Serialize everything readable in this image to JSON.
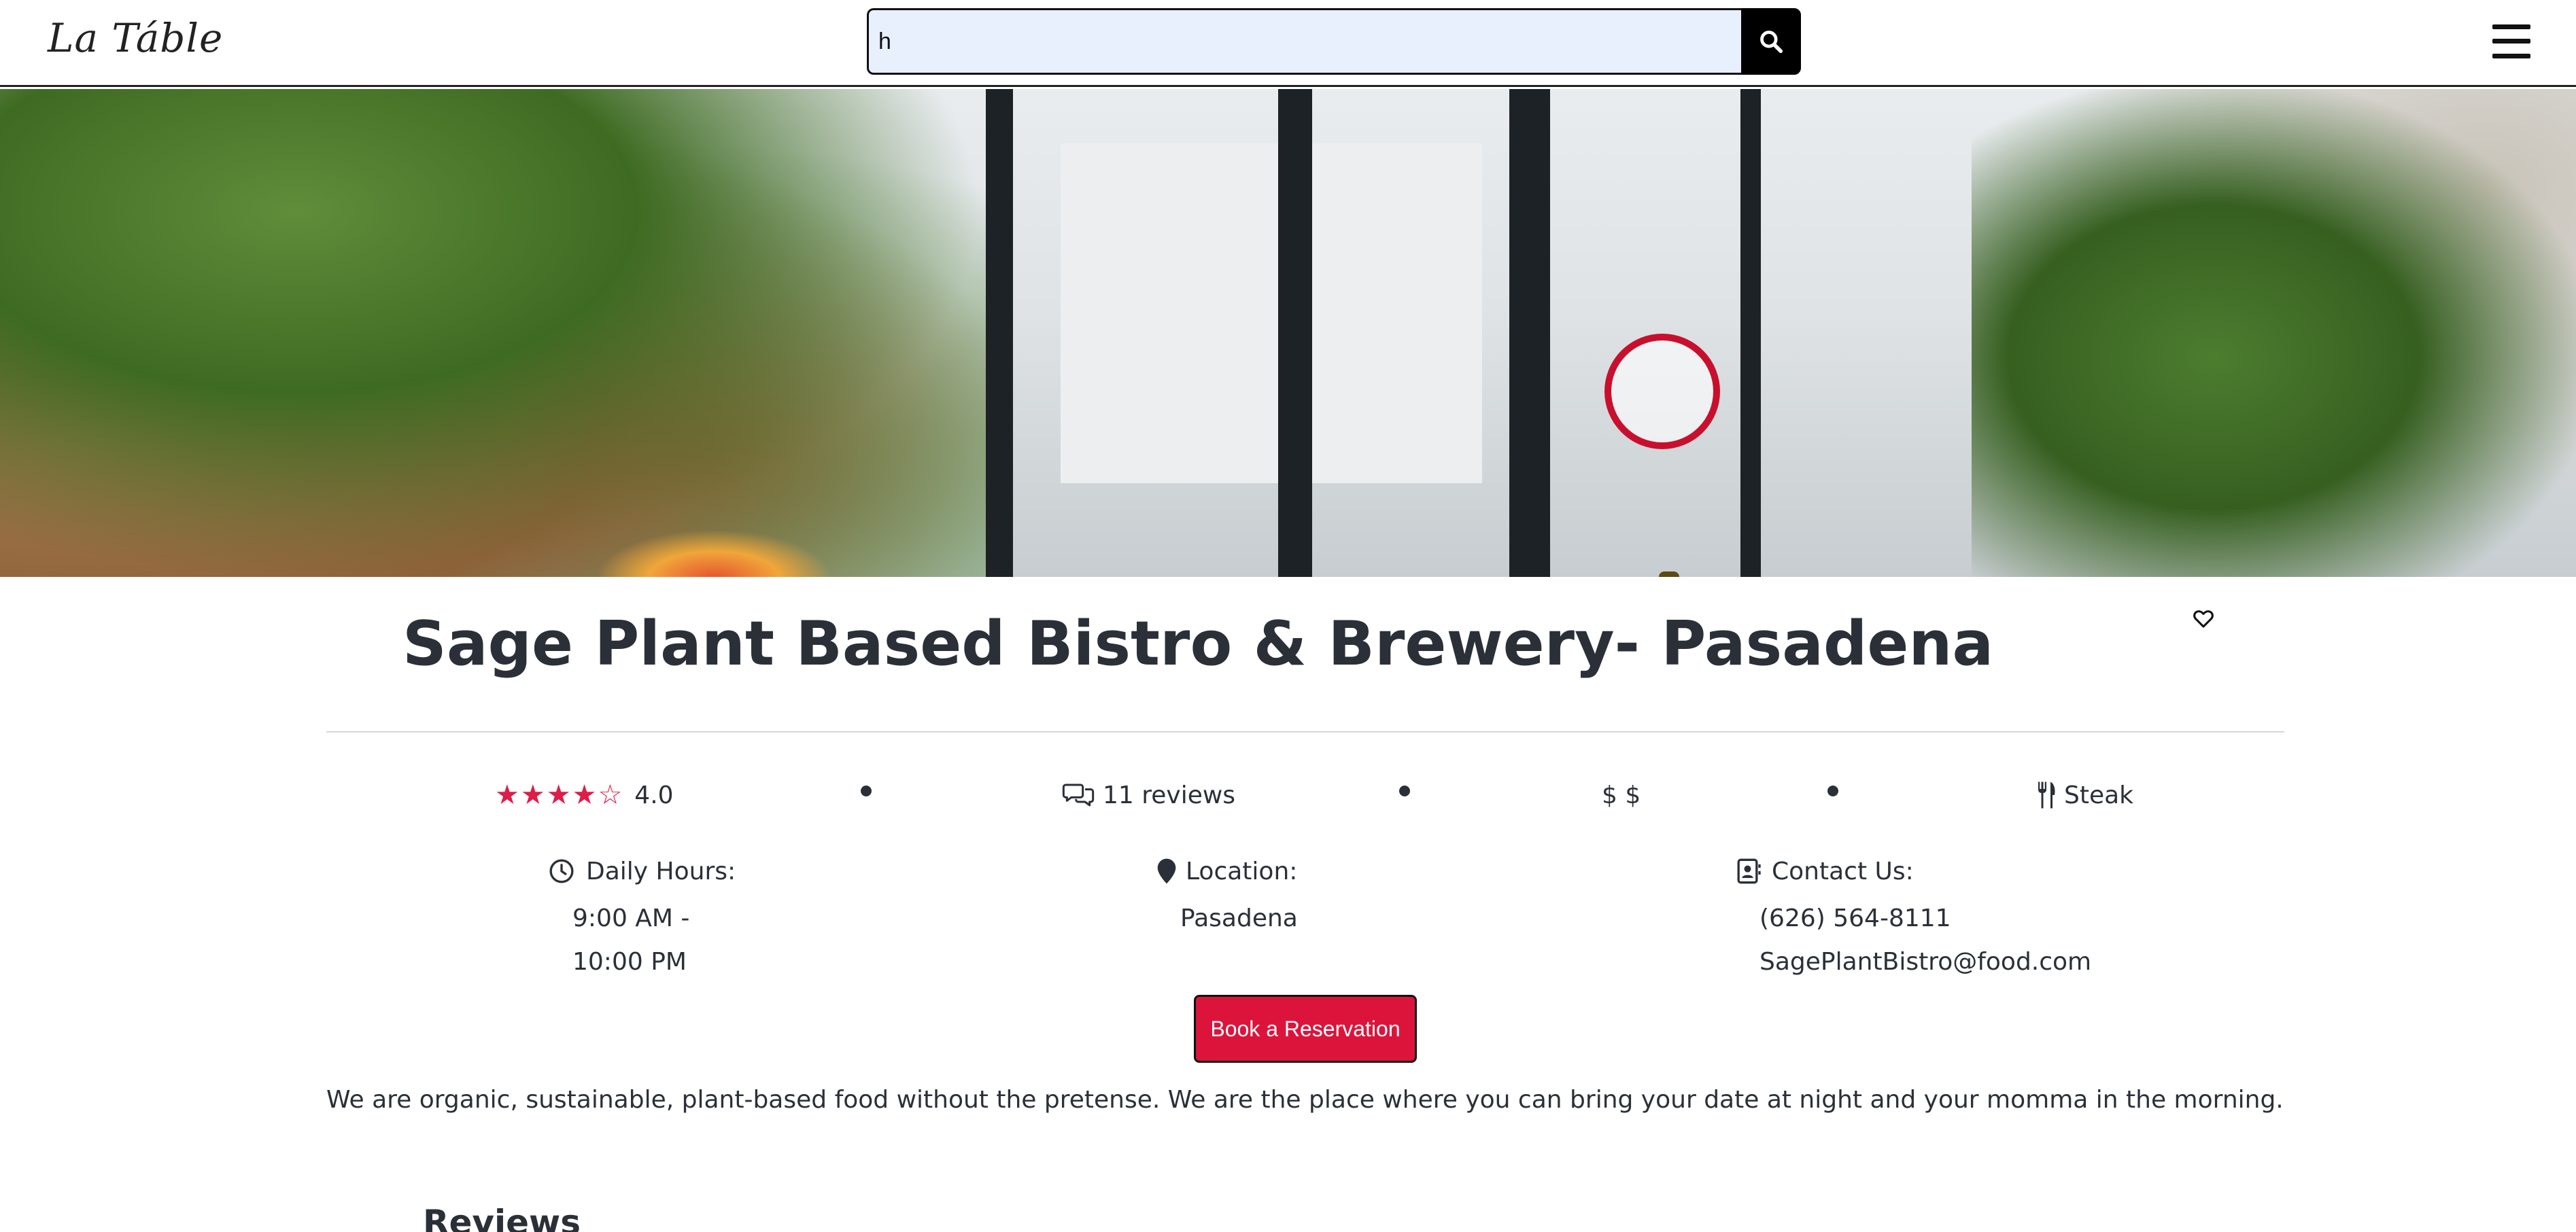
{
  "header": {
    "logo": "La Táble",
    "search": {
      "value": "h",
      "placeholder": ""
    }
  },
  "restaurant": {
    "name": "Sage Plant Based Bistro & Brewery- Pasadena",
    "rating": 4.0,
    "rating_text": "4.0",
    "reviews_text": "11 reviews",
    "price": "$ $",
    "cuisine": "Steak"
  },
  "info": {
    "hours_label": "Daily Hours:",
    "hours_line1": "9:00 AM -",
    "hours_line2": "10:00 PM",
    "location_label": "Location:",
    "location": "Pasadena",
    "contact_label": "Contact Us:",
    "phone": "(626) 564-8111",
    "email": "SagePlantBistro@food.com"
  },
  "actions": {
    "book": "Book a Reservation"
  },
  "description": "We are organic, sustainable, plant-based food without the pretense. We are the place where you can bring your date at night and your momma in the morning.",
  "sections": {
    "reviews_heading": "Reviews"
  },
  "colors": {
    "accent": "#dc143c",
    "star": "#dc1e48",
    "text": "#2b3038",
    "search_bg": "#e8f0fe"
  }
}
